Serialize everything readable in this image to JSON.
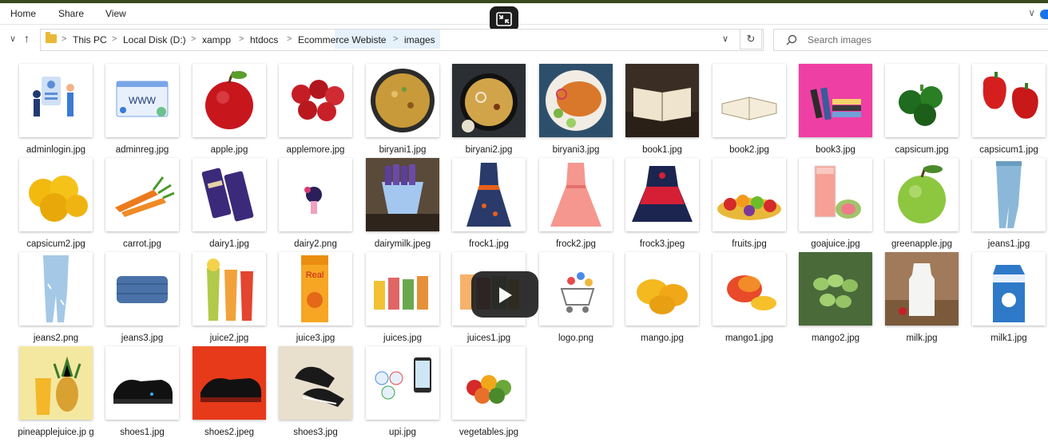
{
  "ribbon": {
    "tabs": [
      "Home",
      "Share",
      "View"
    ]
  },
  "address": {
    "crumbs": [
      "This PC",
      "Local Disk (D:)",
      "xampp",
      "htdocs",
      "Ecommerce Webiste",
      "images"
    ]
  },
  "search": {
    "placeholder": "Search images"
  },
  "files": [
    "adminlogin.jpg",
    "adminreg.jpg",
    "apple.jpg",
    "applemore.jpg",
    "biryani1.jpg",
    "biryani2.jpg",
    "biryani3.jpg",
    "book1.jpg",
    "book2.jpg",
    "book3.jpg",
    "capsicum.jpg",
    "capsicum1.jpg",
    "capsicum2.jpg",
    "carrot.jpg",
    "dairy1.jpg",
    "dairy2.png",
    "dairymilk.jpeg",
    "frock1.jpg",
    "frock2.jpg",
    "frock3.jpeg",
    "fruits.jpg",
    "goajuice.jpg",
    "greenapple.jpg",
    "jeans1.jpg",
    "jeans2.png",
    "jeans3.jpg",
    "juice2.jpg",
    "juice3.jpg",
    "juices.jpg",
    "juices1.jpg",
    "logo.png",
    "mango.jpg",
    "mango1.jpg",
    "mango2.jpg",
    "milk.jpg",
    "milk1.jpg",
    "pineapplejuice.jp g",
    "shoes1.jpg",
    "shoes2.jpeg",
    "shoes3.jpg",
    "upi.jpg",
    "vegetables.jpg"
  ]
}
